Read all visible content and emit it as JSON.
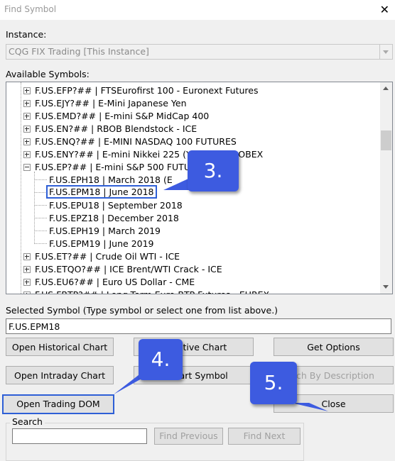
{
  "window": {
    "title": "Find Symbol"
  },
  "instance": {
    "label": "Instance:",
    "value": "CQG FIX Trading [This Instance]"
  },
  "available": {
    "label": "Available Symbols:"
  },
  "tree": [
    {
      "text": "F.US.EFP?##  |  FTSEurofirst 100 - Euronext Futures"
    },
    {
      "text": "F.US.EJY?##  |  E-Mini Japanese Yen"
    },
    {
      "text": "F.US.EMD?##  |  E-mini S&P MidCap 400"
    },
    {
      "text": "F.US.EN?##  |  RBOB Blendstock - ICE"
    },
    {
      "text": "F.US.ENQ?##  |  E-MINI NASDAQ 100 FUTURES"
    },
    {
      "text": "F.US.ENY?##  |  E-mini Nikkei 225 (Y     ated) - GLOBEX"
    },
    {
      "text": "F.US.EP?##  |  E-mini S&P 500 FUTU"
    },
    {
      "text": "F.US.EPH18  |  March 2018 (E"
    },
    {
      "text": "F.US.EPM18  |  June 2018"
    },
    {
      "text": "F.US.EPU18  |  September 2018"
    },
    {
      "text": "F.US.EPZ18  |  December 2018"
    },
    {
      "text": "F.US.EPH19  |  March 2019"
    },
    {
      "text": "F.US.EPM19  |  June 2019"
    },
    {
      "text": "F.US.ET?##  |  Crude Oil WTI - ICE"
    },
    {
      "text": "F.US.ETQO?##  |  ICE Brent/WTI Crack - ICE"
    },
    {
      "text": "F.US.EU6?##  |  Euro US Dollar - CME"
    },
    {
      "text": "F.US.FBTP?##  |  Long-Term Euro-BTP Futures - EUREX"
    }
  ],
  "selected": {
    "label": "Selected Symbol (Type symbol or select one from list above.)",
    "value": "F.US.EPM18"
  },
  "buttons": {
    "historical": "Open Historical Chart",
    "activate": "te Active Chart",
    "options": "Get Options",
    "intraday": "Open Intraday Chart",
    "change": "e Chart Symbol",
    "describe": "rch By Description",
    "dom": "Open Trading DOM",
    "close": "Close"
  },
  "search": {
    "label": "Search",
    "value": "",
    "find_previous": "Find Previous",
    "find_next": "Find Next"
  },
  "callouts": {
    "c3": "3.",
    "c4": "4.",
    "c5": "5."
  },
  "colors": {
    "callout": "#3d5be0",
    "highlight": "#2e5fd6"
  }
}
